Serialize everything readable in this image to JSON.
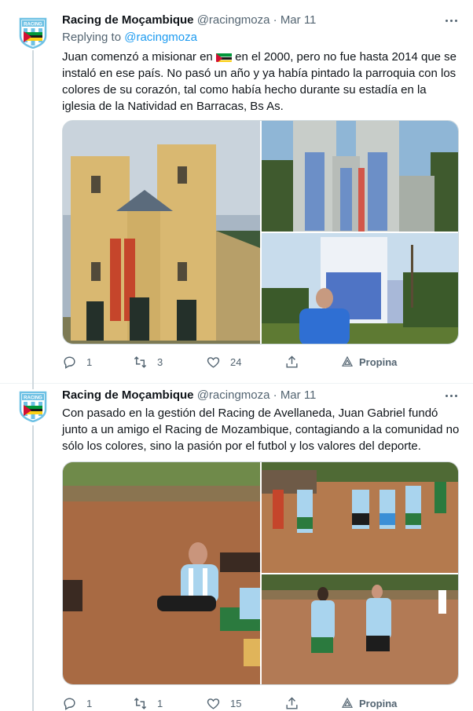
{
  "tweets": [
    {
      "author_name": "Racing de Moçambique",
      "author_handle": "@racingmoza",
      "separator": "·",
      "date": "Mar 11",
      "replying_prefix": "Replying to",
      "replying_to": "@racingmoza",
      "text_before_flag": "Juan comenzó a misionar en",
      "text_after_flag": "en el 2000, pero no fue hasta 2014 que se instaló en ese país. No pasó un año y ya había pintado la parroquia con los colores de su corazón, tal como había hecho durante su estadía en la iglesia de la Natividad en Barracas, Bs As.",
      "flag_icon": "mozambique-flag-emoji",
      "replies": "1",
      "retweets": "3",
      "likes": "24",
      "tip_label": "Propina"
    },
    {
      "author_name": "Racing de Moçambique",
      "author_handle": "@racingmoza",
      "separator": "·",
      "date": "Mar 11",
      "text": "Con pasado en la gestión del Racing de Avellaneda, Juan Gabriel fundó junto a un amigo el Racing de Mozambique, contagiando a la comunidad no sólo los colores, sino la pasión por el futbol y los valores del deporte.",
      "replies": "1",
      "retweets": "1",
      "likes": "15",
      "tip_label": "Propina"
    }
  ],
  "avatar_text": "RACING",
  "icons": {
    "reply": "reply-icon",
    "retweet": "retweet-icon",
    "like": "heart-icon",
    "share": "share-icon",
    "tip": "tip-icon",
    "more": "more-icon"
  },
  "colors": {
    "accent": "#1d9bf0",
    "secondary_text": "#536471",
    "racing_blue": "#6ec1e4"
  }
}
